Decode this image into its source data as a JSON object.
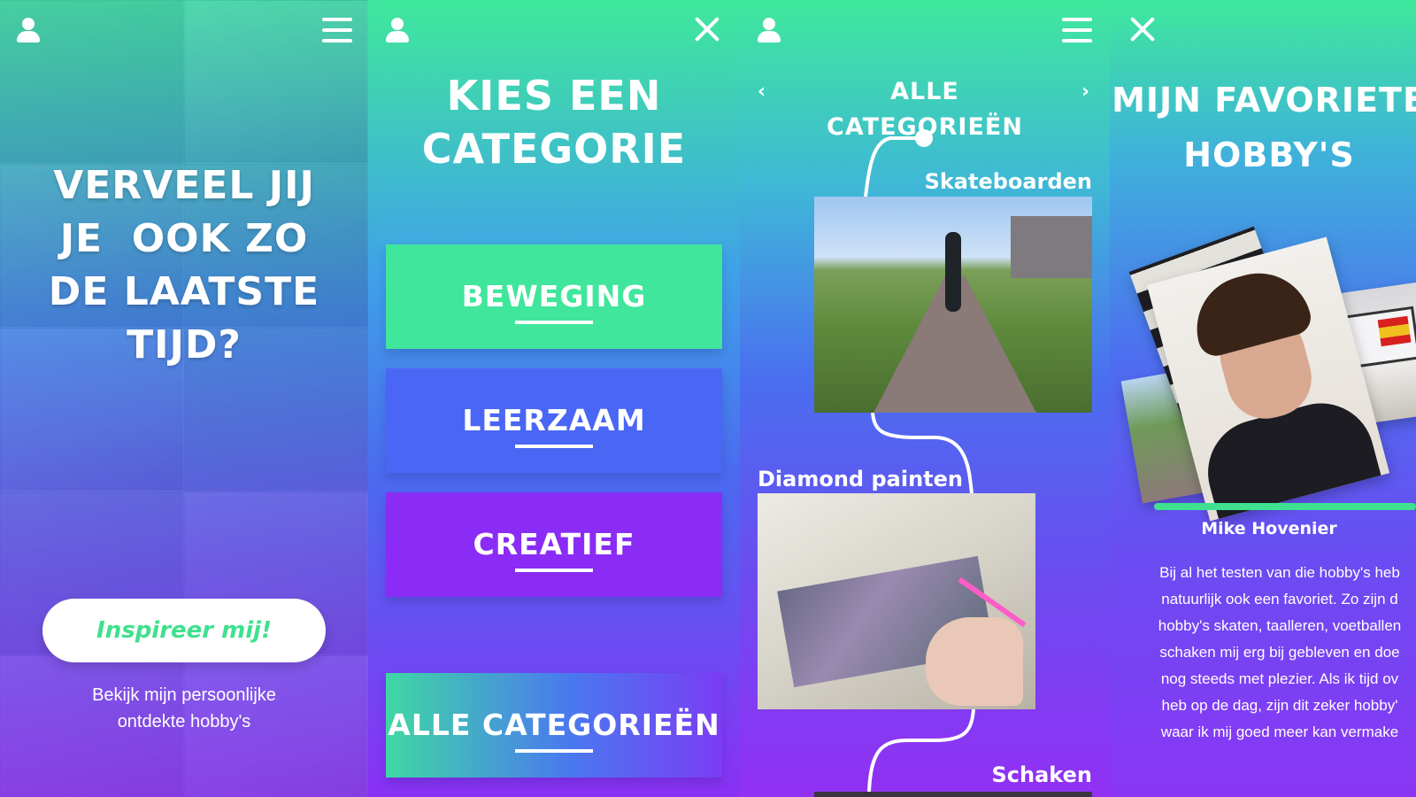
{
  "screen1": {
    "headline_lines": [
      "VERVEEL JIJ",
      "JE  OOK ZO",
      "DE LAATSTE",
      "TIJD?"
    ],
    "cta_label": "Inspireer mij!",
    "subtext_lines": [
      "Bekijk mijn persoonlijke",
      "ontdekte hobby's"
    ],
    "icons": [
      "user-icon",
      "menu-icon"
    ]
  },
  "screen2": {
    "title_lines": [
      "KIES EEN",
      "CATEGORIE"
    ],
    "categories": [
      {
        "label": "BEWEGING",
        "color": "#3fe69c"
      },
      {
        "label": "LEERZAAM",
        "color": "#4a66f4"
      },
      {
        "label": "CREATIEF",
        "color": "#8a2cf6"
      }
    ],
    "all_label": "ALLE CATEGORIEËN",
    "icons": [
      "user-icon",
      "close-icon"
    ]
  },
  "screen3": {
    "nav_label": "ALLE CATEGORIEËN",
    "prev_glyph": "‹",
    "next_glyph": "›",
    "hobbies": [
      {
        "label": "Skateboarden"
      },
      {
        "label": "Diamond painten"
      },
      {
        "label": "Schaken"
      }
    ],
    "icons": [
      "user-icon",
      "menu-icon"
    ]
  },
  "screen4": {
    "title_lines": [
      "MIJN FAVORIETE",
      "HOBBY'S"
    ],
    "person_name": "Mike Hovenier",
    "bio_lines": [
      "Bij al het testen van die hobby's heb",
      "natuurlijk ook een favoriet. Zo zijn d",
      "hobby's skaten, taalleren, voetballen",
      "schaken mij erg bij gebleven en doe",
      "nog steeds met plezier. Als ik tijd ov",
      "heb op de dag, zijn dit zeker hobby'",
      "waar ik mij goed meer kan vermake"
    ],
    "icons": [
      "close-icon"
    ]
  },
  "colors": {
    "accent_green": "#3fe08e",
    "blue": "#4a66f4",
    "purple": "#8a2cf6",
    "white": "#ffffff"
  }
}
